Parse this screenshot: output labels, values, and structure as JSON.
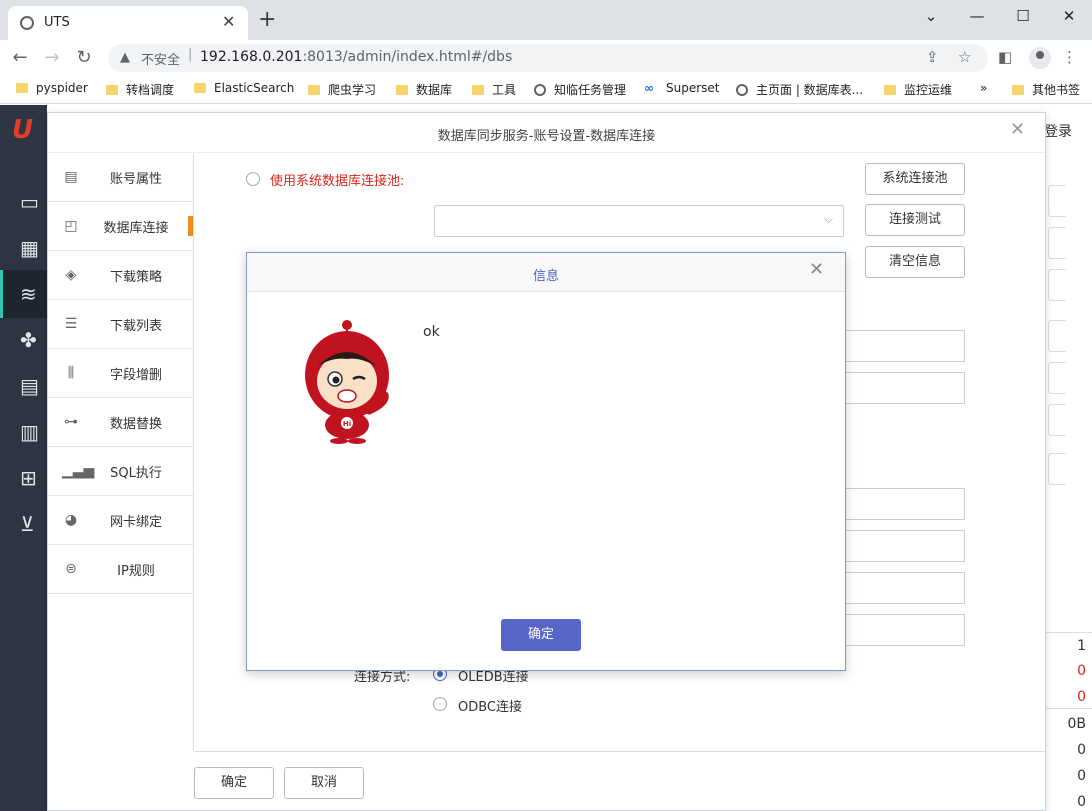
{
  "browser": {
    "tab_title": "UTS",
    "insecure_label": "不安全",
    "url_host": "192.168.0.201",
    "url_rest": ":8013/admin/index.html#/dbs",
    "bookmarks": [
      {
        "label": "pyspider",
        "icon": "folder-icon"
      },
      {
        "label": "转档调度",
        "icon": "folder-icon"
      },
      {
        "label": "ElasticSearch",
        "icon": "folder-icon"
      },
      {
        "label": "爬虫学习",
        "icon": "folder-icon"
      },
      {
        "label": "数据库",
        "icon": "folder-icon"
      },
      {
        "label": "工具",
        "icon": "folder-icon"
      },
      {
        "label": "知临任务管理",
        "icon": "globe-icon"
      },
      {
        "label": "Superset",
        "icon": "superset-icon"
      },
      {
        "label": "主页面 | 数据库表...",
        "icon": "globe-icon"
      },
      {
        "label": "监控运维",
        "icon": "folder-icon"
      },
      {
        "label": "其他书签",
        "icon": "folder-icon"
      }
    ],
    "more_bookmarks": "»"
  },
  "app": {
    "login_label": "登录",
    "right_values": [
      "1",
      "0",
      "0",
      "0B",
      "0",
      "0",
      "0"
    ],
    "accent_red": "#d9261c"
  },
  "modal": {
    "title": "数据库同步服务-账号设置-数据库连接",
    "menu": [
      {
        "label": "账号属性",
        "icon": "id-card-icon"
      },
      {
        "label": "数据库连接",
        "icon": "chart-monitor-icon",
        "active": true
      },
      {
        "label": "下载策略",
        "icon": "diamond-icon"
      },
      {
        "label": "下载列表",
        "icon": "list-icon"
      },
      {
        "label": "字段增删",
        "icon": "columns-icon"
      },
      {
        "label": "数据替换",
        "icon": "flow-icon"
      },
      {
        "label": "SQL执行",
        "icon": "bar-chart-icon"
      },
      {
        "label": "网卡绑定",
        "icon": "pie-icon"
      },
      {
        "label": "IP规则",
        "icon": "rule-icon"
      }
    ],
    "use_pool_label": "使用系统数据库连接池:",
    "pool_select_value": "",
    "buttons": {
      "system_pool": "系统连接池",
      "test_connection": "连接测试",
      "clear_info": "清空信息"
    },
    "connection_mode_label": "连接方式:",
    "connection_options": [
      {
        "label": "OLEDB连接",
        "checked": true
      },
      {
        "label": "ODBC连接",
        "checked": false
      }
    ],
    "footer": {
      "ok": "确定",
      "cancel": "取消"
    }
  },
  "info_dialog": {
    "title": "信息",
    "message": "ok",
    "ok_button": "确定",
    "button_color": "#5865c8"
  }
}
